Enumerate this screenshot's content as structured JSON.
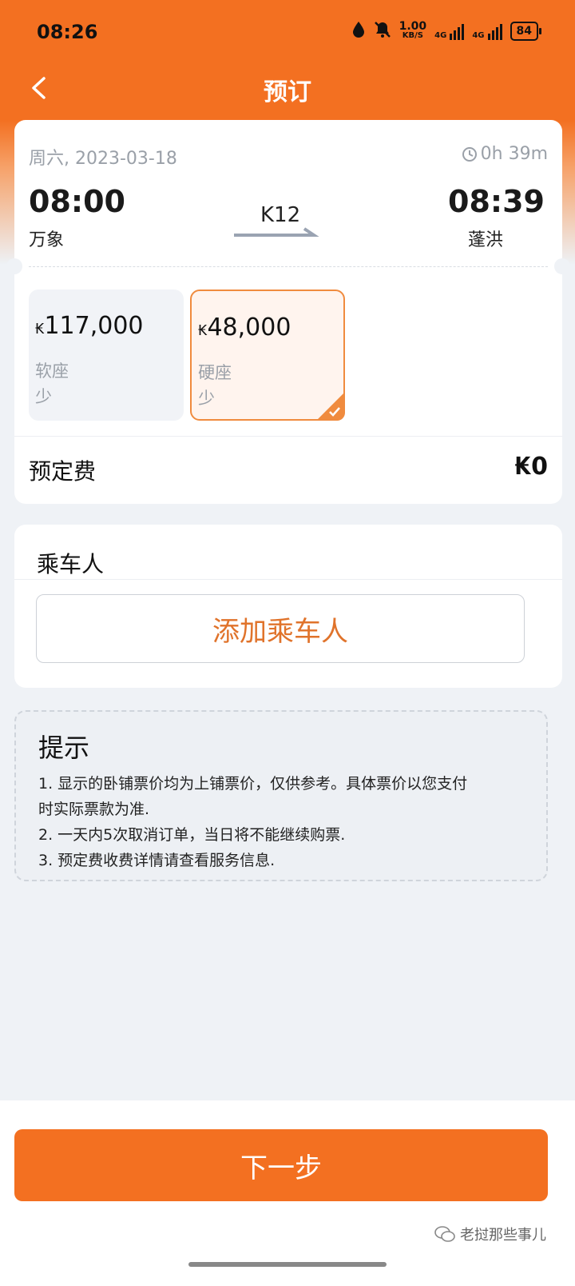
{
  "status_bar": {
    "time": "08:26",
    "net_speed": "1.00",
    "net_unit": "KB/S",
    "signal_1_label": "4G",
    "signal_2_label": "4G",
    "battery": "84"
  },
  "nav": {
    "title": "预订",
    "back_icon": "chevron-left-icon"
  },
  "trip": {
    "date": "周六, 2023-03-18",
    "duration": "0h 39m",
    "departure_time": "08:00",
    "departure_station": "万象",
    "arrival_time": "08:39",
    "arrival_station": "蓬洪",
    "train_number": "K12"
  },
  "seats": [
    {
      "currency": "₭",
      "price": "117,000",
      "class": "软座",
      "availability": "少",
      "selected": false
    },
    {
      "currency": "₭",
      "price": "48,000",
      "class": "硬座",
      "availability": "少",
      "selected": true
    }
  ],
  "booking_fee": {
    "label": "预定费",
    "value": "₭0"
  },
  "passengers": {
    "title": "乘车人",
    "add_button": "添加乘车人"
  },
  "tips": {
    "title": "提示",
    "lines": [
      "1. 显示的卧铺票价均为上铺票价，仅供参考。具体票价以您支付",
      "时实际票款为准.",
      "2. 一天内5次取消订单，当日将不能继续购票.",
      "3. 预定费收费详情请查看服务信息."
    ]
  },
  "footer": {
    "next_button": "下一步",
    "watermark": "老挝那些事儿"
  },
  "colors": {
    "brand": "#f37021",
    "selected_border": "#f08b3e",
    "add_text": "#e0732b"
  }
}
